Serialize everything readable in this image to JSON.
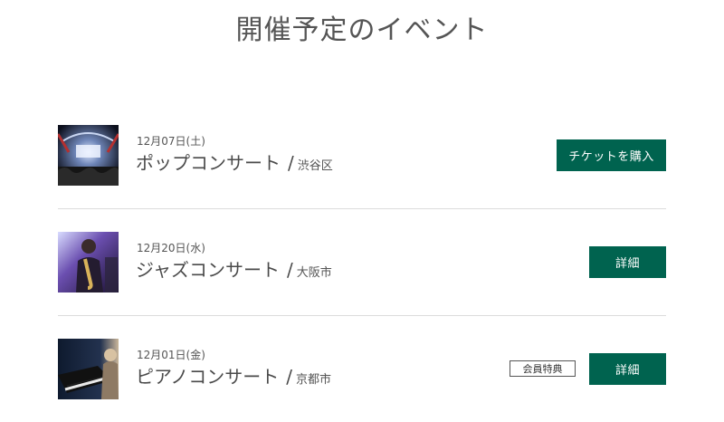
{
  "page": {
    "title": "開催予定のイベント"
  },
  "events": [
    {
      "date": "12月07日(土)",
      "title": "ポップコンサート",
      "separator": "/",
      "venue": "渋谷区",
      "action_label": "チケットを購入",
      "image": "concert-stage-photo"
    },
    {
      "date": "12月20日(水)",
      "title": "ジャズコンサート",
      "separator": "/",
      "venue": "大阪市",
      "action_label": "詳細",
      "image": "saxophone-player-photo"
    },
    {
      "date": "12月01日(金)",
      "title": "ピアノコンサート",
      "separator": "/",
      "venue": "京都市",
      "badge": "会員特典",
      "action_label": "詳細",
      "image": "piano-player-photo"
    }
  ],
  "colors": {
    "accent": "#00634f",
    "divider": "#dcdcdc",
    "text": "#4a4a4a"
  }
}
